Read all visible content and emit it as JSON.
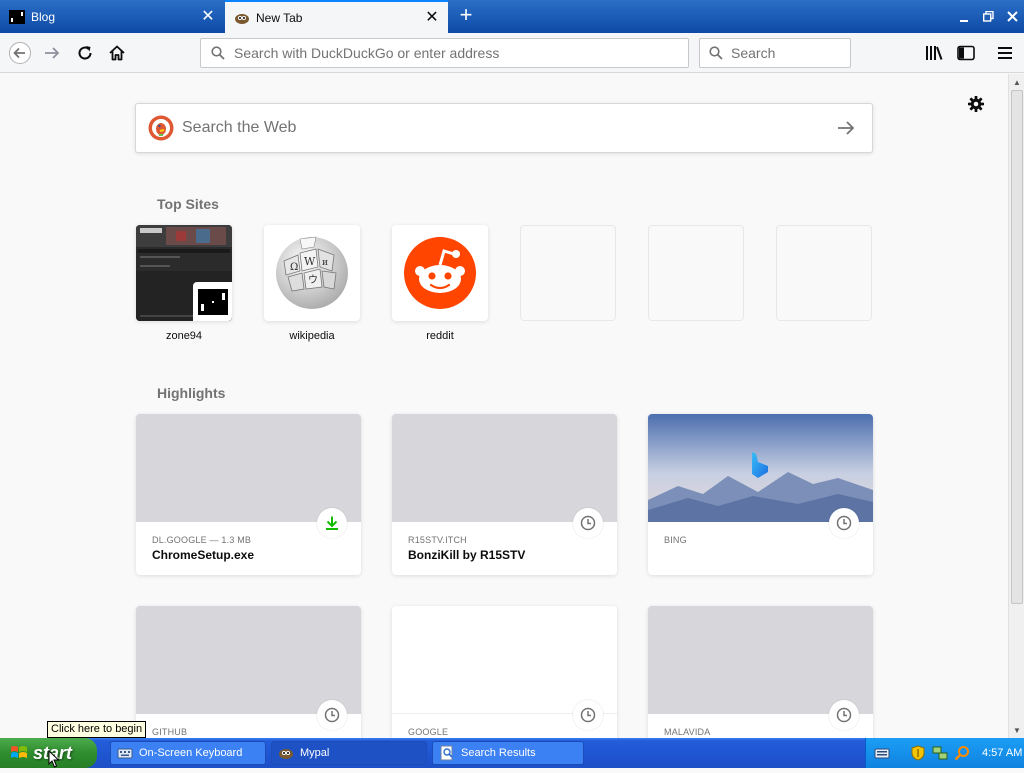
{
  "tabs": [
    {
      "label": "Blog",
      "icon": "blog-favicon"
    },
    {
      "label": "New Tab",
      "icon": "mypal-favicon",
      "active": true
    }
  ],
  "toolbar": {
    "url_placeholder": "Search with DuckDuckGo or enter address",
    "search_placeholder": "Search"
  },
  "page": {
    "websearch_placeholder": "Search the Web",
    "top_sites_title": "Top Sites",
    "highlights_title": "Highlights",
    "top_sites": [
      {
        "name": "zone94"
      },
      {
        "name": "wikipedia"
      },
      {
        "name": "reddit"
      },
      {
        "name": ""
      },
      {
        "name": ""
      },
      {
        "name": ""
      }
    ],
    "highlights": [
      {
        "source": "DL.GOOGLE — 1.3 MB",
        "title": "ChromeSetup.exe",
        "badge": "download-icon"
      },
      {
        "source": "R15STV.ITCH",
        "title": "BonziKill by R15STV",
        "badge": "clock-icon"
      },
      {
        "source": "BING",
        "title": "",
        "badge": "clock-icon"
      },
      {
        "source": "GITHUB",
        "title": "",
        "badge": "clock-icon"
      },
      {
        "source": "GOOGLE",
        "title": "",
        "badge": "clock-icon"
      },
      {
        "source": "MALAVIDA",
        "title": "",
        "badge": "clock-icon"
      }
    ]
  },
  "taskbar": {
    "start_label": "start",
    "tooltip": "Click here to begin",
    "tasks": [
      {
        "label": "On-Screen Keyboard"
      },
      {
        "label": "Mypal"
      },
      {
        "label": "Search Results"
      }
    ],
    "clock": "4:57 AM"
  },
  "colors": {
    "accent": "#0a84ff",
    "tabstrip": "#1e5fb4",
    "download_green": "#12bc00",
    "reddit": "#ff4500",
    "taskbar": "#245edb",
    "start_green": "#2f8d2f"
  }
}
